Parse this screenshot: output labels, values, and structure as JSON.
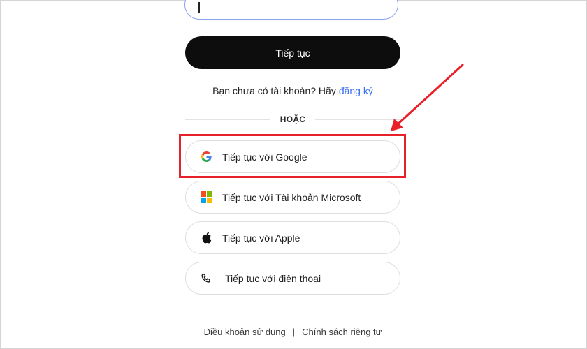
{
  "form": {
    "email_value": "",
    "continue_label": "Tiếp tục",
    "signup_prompt": "Bạn chưa có tài khoản? Hãy",
    "signup_link": "đăng ký",
    "divider_text": "HOẶC"
  },
  "social_buttons": {
    "google": {
      "label": "Tiếp tục với Google",
      "icon": "google-icon"
    },
    "microsoft": {
      "label": "Tiếp tục với Tài khoản Microsoft",
      "icon": "microsoft-icon"
    },
    "apple": {
      "label": "Tiếp tục với Apple",
      "icon": "apple-icon"
    },
    "phone": {
      "label": "Tiếp tục với điện thoại",
      "icon": "phone-icon"
    }
  },
  "footer": {
    "terms": "Điều khoản sử dụng",
    "separator": "|",
    "privacy": "Chính sách riêng tư"
  },
  "annotation": {
    "color": "#e8202a"
  },
  "colors": {
    "primary_button": "#0d0d0d",
    "link": "#3b6ff2",
    "input_border": "#8aa4f0"
  }
}
